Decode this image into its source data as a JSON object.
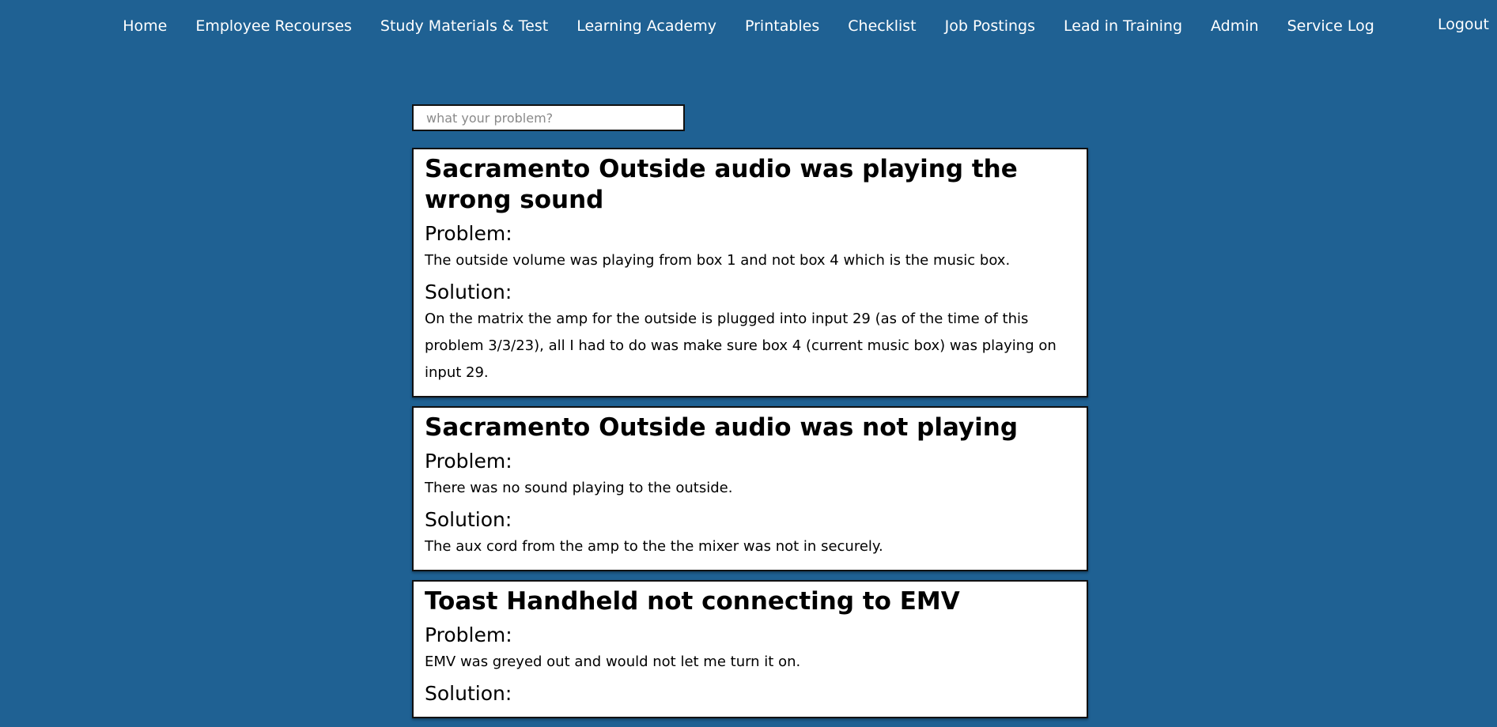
{
  "nav": {
    "items": [
      {
        "label": "Home"
      },
      {
        "label": "Employee Recourses"
      },
      {
        "label": "Study Materials & Test"
      },
      {
        "label": "Learning Academy"
      },
      {
        "label": "Printables"
      },
      {
        "label": "Checklist"
      },
      {
        "label": "Job Postings"
      },
      {
        "label": "Lead in Training"
      },
      {
        "label": "Admin"
      },
      {
        "label": "Service Log"
      }
    ],
    "logout": "Logout"
  },
  "search": {
    "placeholder": "what your problem?",
    "value": ""
  },
  "entries": [
    {
      "title": "Sacramento Outside audio was playing the wrong sound",
      "problem_label": "Problem:",
      "problem": "The outside volume was playing from box 1 and not box 4 which is the music box.",
      "solution_label": "Solution:",
      "solution": "On the matrix the amp for the outside is plugged into input 29 (as of the time of this problem 3/3/23), all I had to do was make sure box 4 (current music box) was playing on input 29."
    },
    {
      "title": "Sacramento Outside audio was not playing",
      "problem_label": "Problem:",
      "problem": "There was no sound playing to the outside.",
      "solution_label": "Solution:",
      "solution": "The aux cord from the amp to the the mixer was not in securely."
    },
    {
      "title": "Toast Handheld not connecting to EMV",
      "problem_label": "Problem:",
      "problem": "EMV was greyed out and would not let me turn it on.",
      "solution_label": "Solution:",
      "solution": ""
    }
  ],
  "colors": {
    "background": "#1f6193",
    "card": "#ffffff",
    "border": "#111111"
  }
}
